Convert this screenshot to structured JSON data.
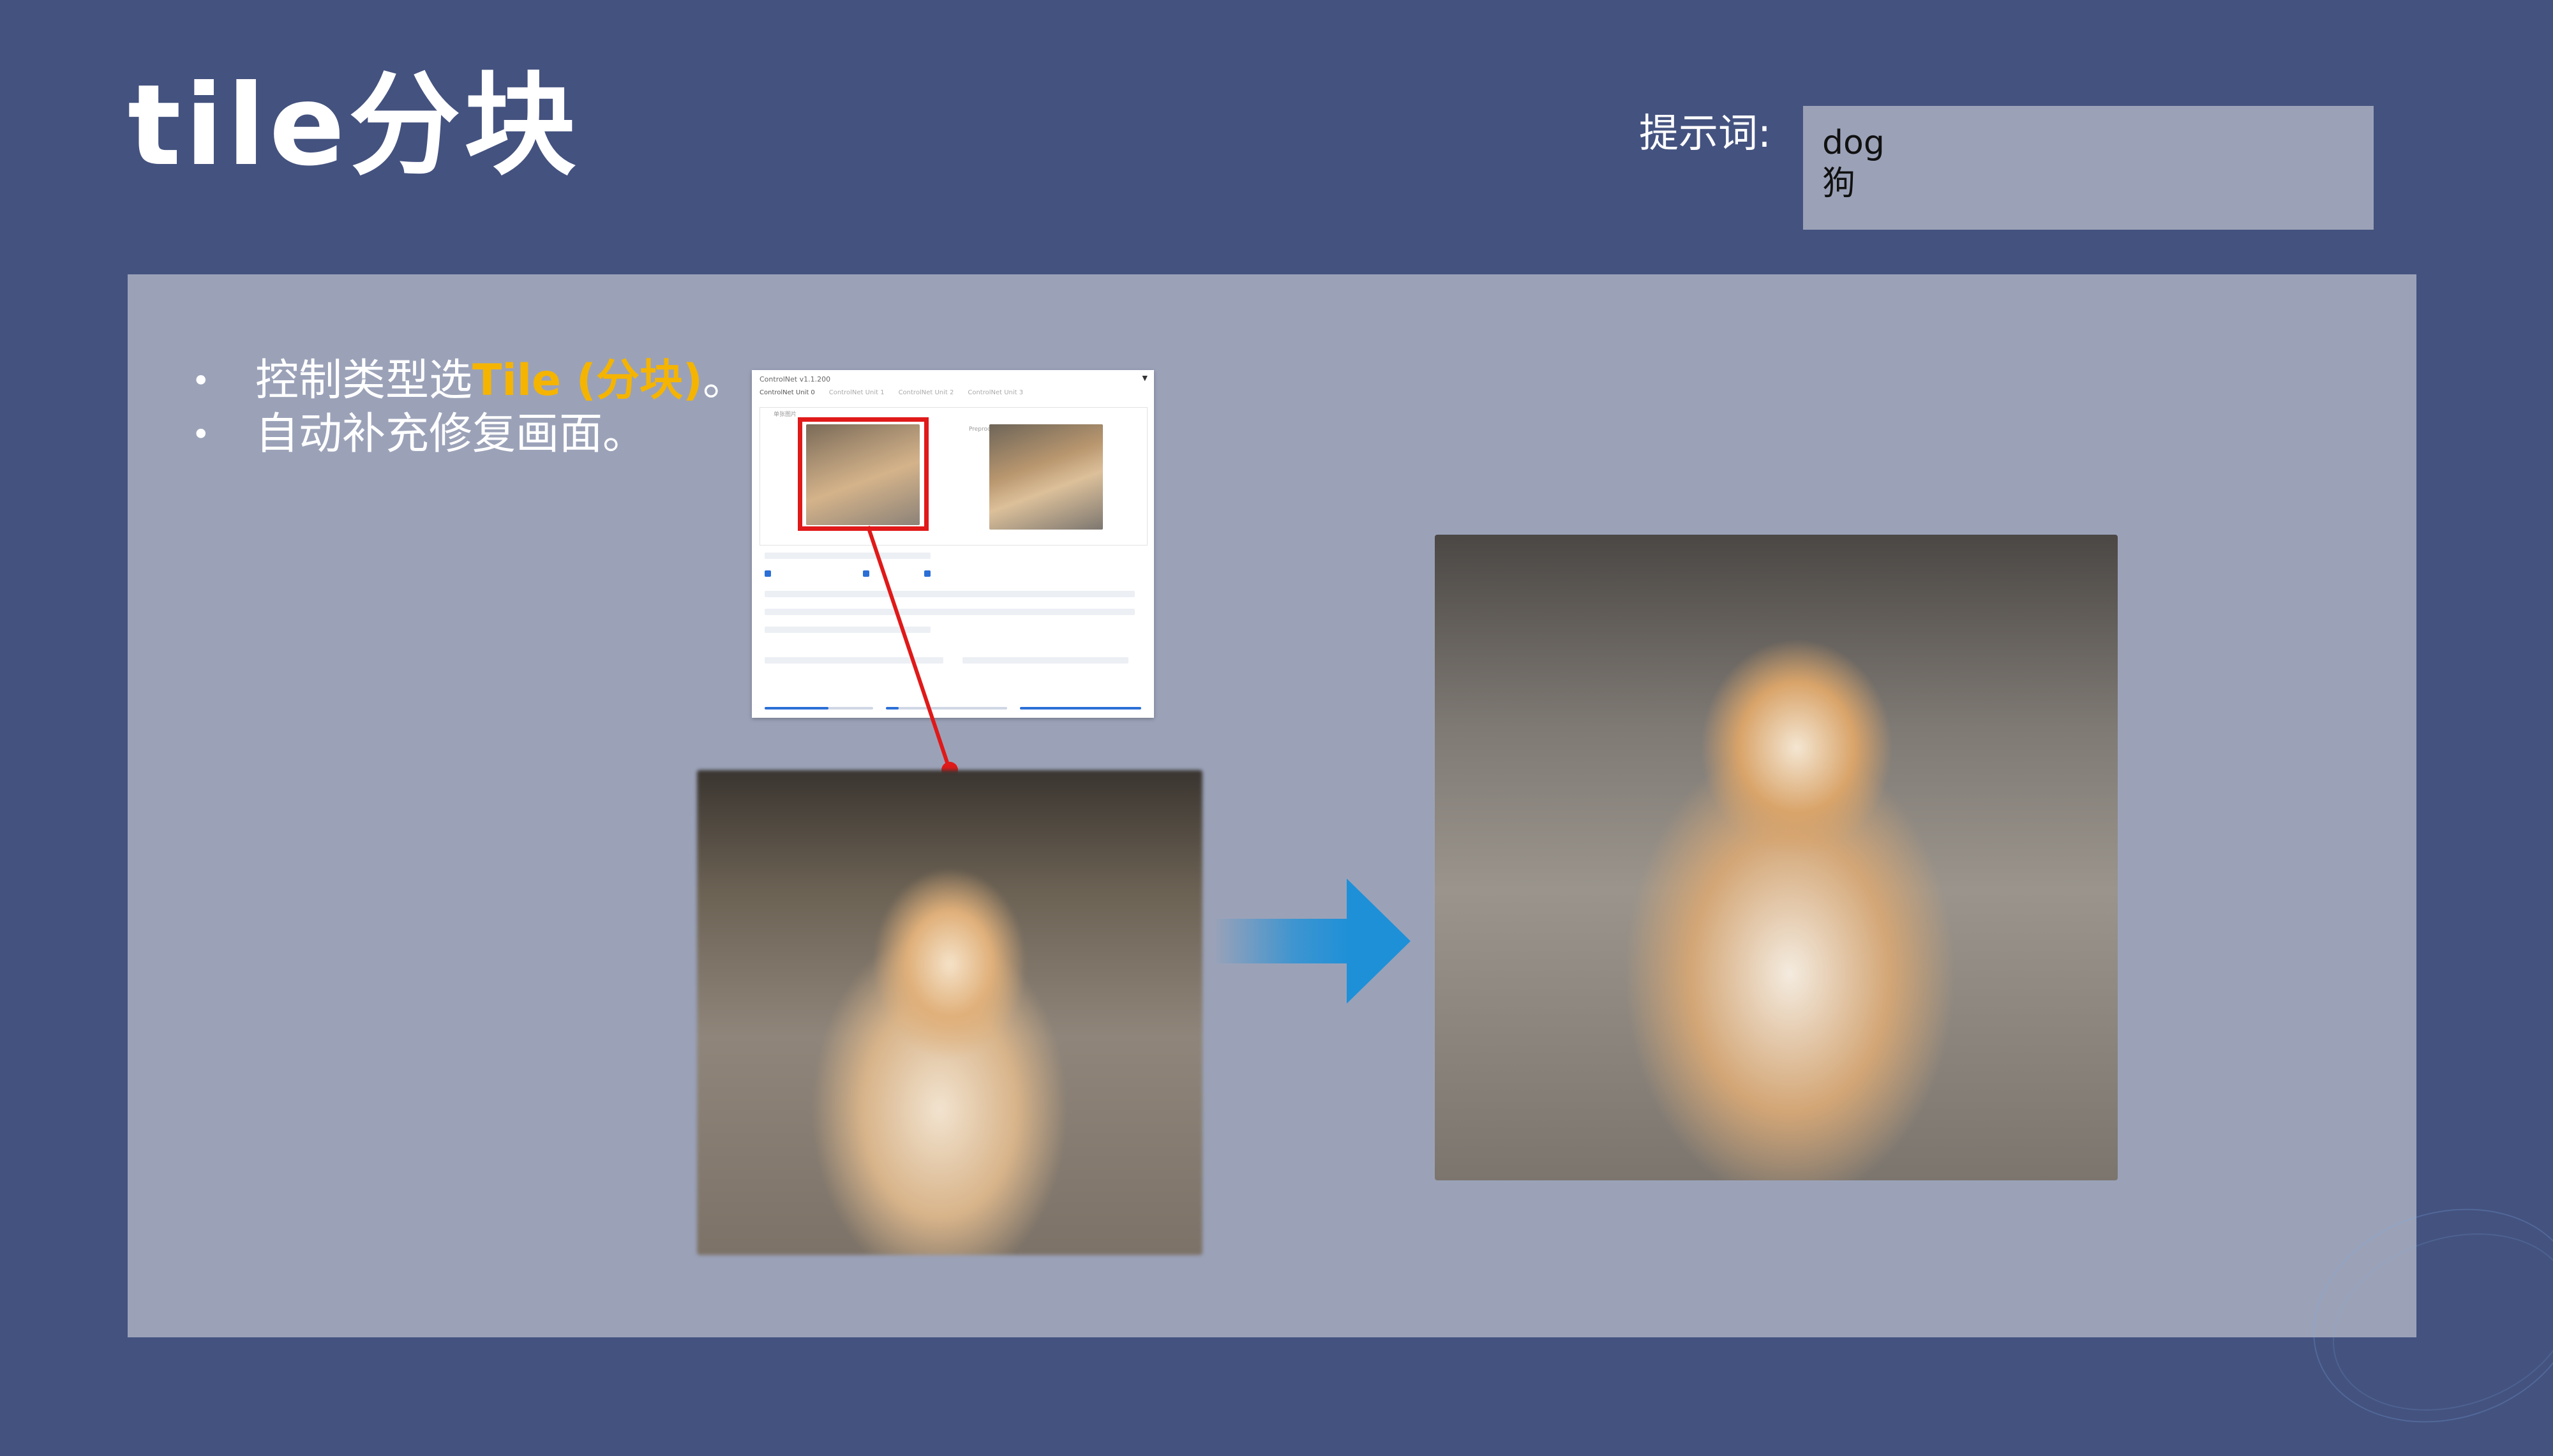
{
  "slide": {
    "title": "tile分块",
    "prompt_label": "提示词:",
    "prompt_lines": [
      "dog",
      "狗"
    ]
  },
  "bullets": [
    {
      "prefix": "控制类型选",
      "highlight": "Tile (分块)",
      "suffix": "。"
    },
    {
      "text": "自动补充修复画面。"
    }
  ],
  "controlnet_screenshot": {
    "header": "ControlNet v1.1.200",
    "tabs": [
      "ControlNet Unit 0",
      "ControlNet Unit 1",
      "ControlNet Unit 2",
      "ControlNet Unit 3"
    ],
    "image_label": "单张图片",
    "preview_label": "Preprocessor Preview"
  },
  "icons": {
    "flow_arrow": "arrow-right-icon",
    "collapse": "triangle-down-icon"
  },
  "colors": {
    "background": "#44527f",
    "panel": "#9ba2b8",
    "highlight": "#f5b400",
    "callout": "#e01919",
    "arrow": "#1e90d8"
  }
}
